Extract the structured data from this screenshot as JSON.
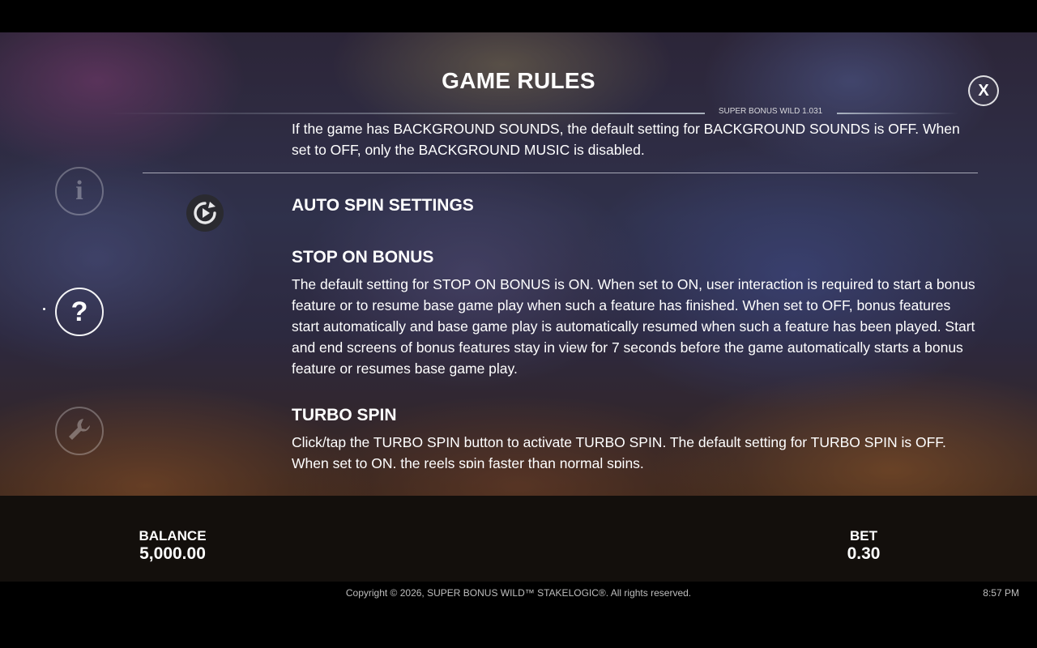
{
  "header": {
    "title": "GAME RULES",
    "version": "SUPER BONUS WILD 1.031",
    "close_label": "X"
  },
  "sidebar": {
    "items": [
      {
        "icon": "info-icon",
        "glyph": "i",
        "state": "dim"
      },
      {
        "icon": "question-icon",
        "glyph": "?",
        "state": "active"
      },
      {
        "icon": "wrench-icon",
        "glyph": "",
        "state": "dim"
      }
    ]
  },
  "rules": {
    "partial_top_line": "If the game has BACKGROUND SOUNDS, the default setting for BACKGROUND SOUNDS is OFF. When",
    "partial_paragraph": "set to OFF, only the BACKGROUND MUSIC is disabled.",
    "section_icon": "autospin-icon",
    "section_title": "AUTO SPIN SETTINGS",
    "stop_on_bonus": {
      "heading": "STOP ON BONUS",
      "body": "The default setting for STOP ON BONUS is ON. When set to ON, user interaction is required to start a bonus feature or to resume base game play when such a feature has finished. When set to OFF, bonus features start automatically and base game play is automatically resumed when such a feature has been played. Start and end screens of bonus features stay in view for 7 seconds before the game automatically starts a bonus feature or resumes base game play."
    },
    "turbo_spin": {
      "heading": "TURBO SPIN",
      "body": "Click/tap the TURBO SPIN button to activate TURBO SPIN. The default setting for TURBO SPIN is OFF. When set to ON, the reels spin faster than normal spins."
    }
  },
  "status": {
    "balance_label": "BALANCE",
    "balance_value": "5,000.00",
    "bet_label": "BET",
    "bet_value": "0.30"
  },
  "footer": {
    "copyright": "Copyright © 2026, SUPER BONUS WILD™ STAKELOGIC®. All rights reserved.",
    "time": "8:57 PM"
  }
}
